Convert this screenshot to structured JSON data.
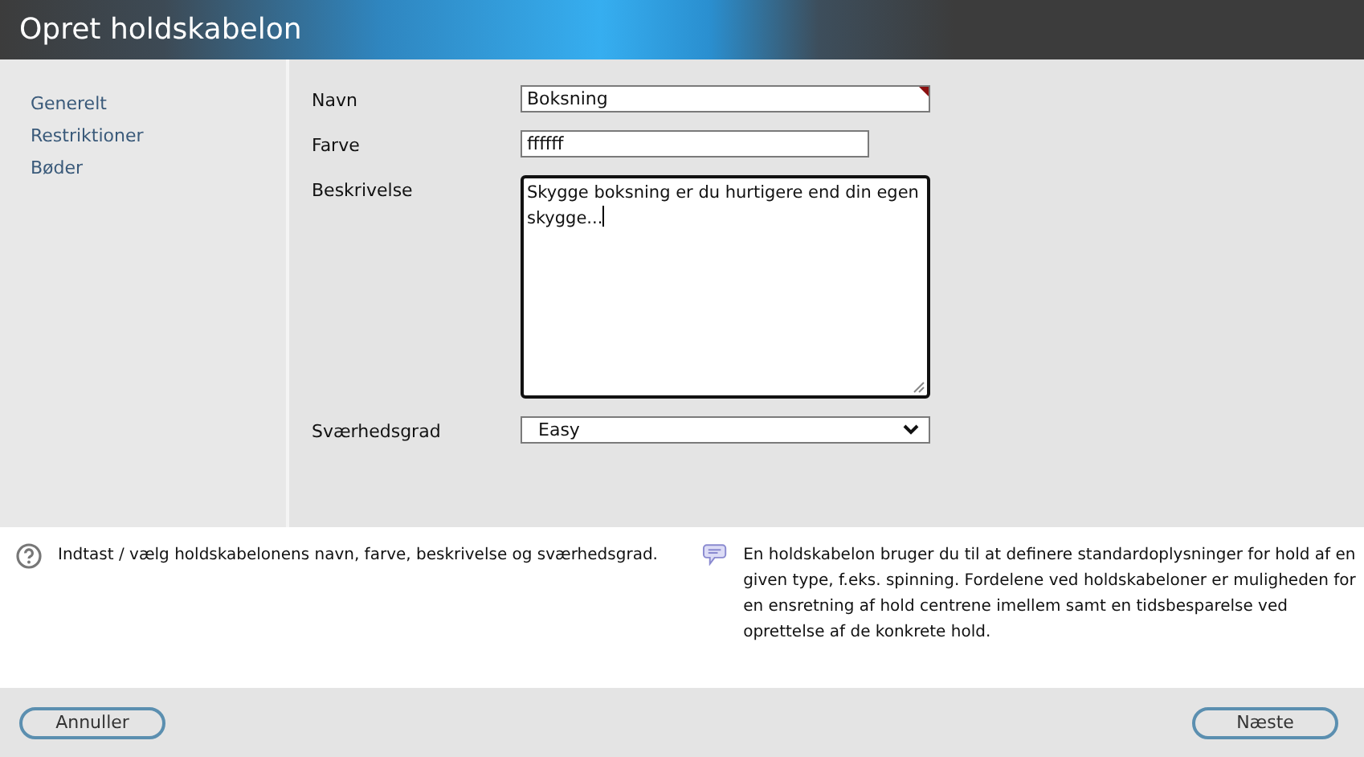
{
  "window": {
    "title": "Opret holdskabelon"
  },
  "sidebar": {
    "items": [
      {
        "label": "Generelt"
      },
      {
        "label": "Restriktioner"
      },
      {
        "label": "Bøder"
      }
    ]
  },
  "form": {
    "fields": [
      {
        "kind": "text",
        "label": "Navn",
        "value": "Boksning",
        "required": true
      },
      {
        "kind": "color",
        "label": "Farve",
        "value": "ffffff",
        "required": false
      },
      {
        "kind": "textarea",
        "label": "Beskrivelse",
        "value": "Skygge boksning er du hurtigere end din egen skygge...",
        "required": false
      },
      {
        "kind": "select",
        "label": "Sværhedsgrad",
        "value": "Easy",
        "required": false
      }
    ]
  },
  "help": {
    "hint": "Indtast / vælg holdskabelonens navn, farve, beskrivelse og sværhedsgrad.",
    "info": "En holdskabelon bruger du til at definere standardoplysninger for hold af en given type, f.eks. spinning. Fordelene ved holdskabeloner er muligheden for en ensretning af hold centrene imellem samt en tidsbesparelse ved oprettelse af de konkrete hold."
  },
  "buttons": [
    {
      "label": "Annuller"
    },
    {
      "label": "Næste"
    }
  ]
}
